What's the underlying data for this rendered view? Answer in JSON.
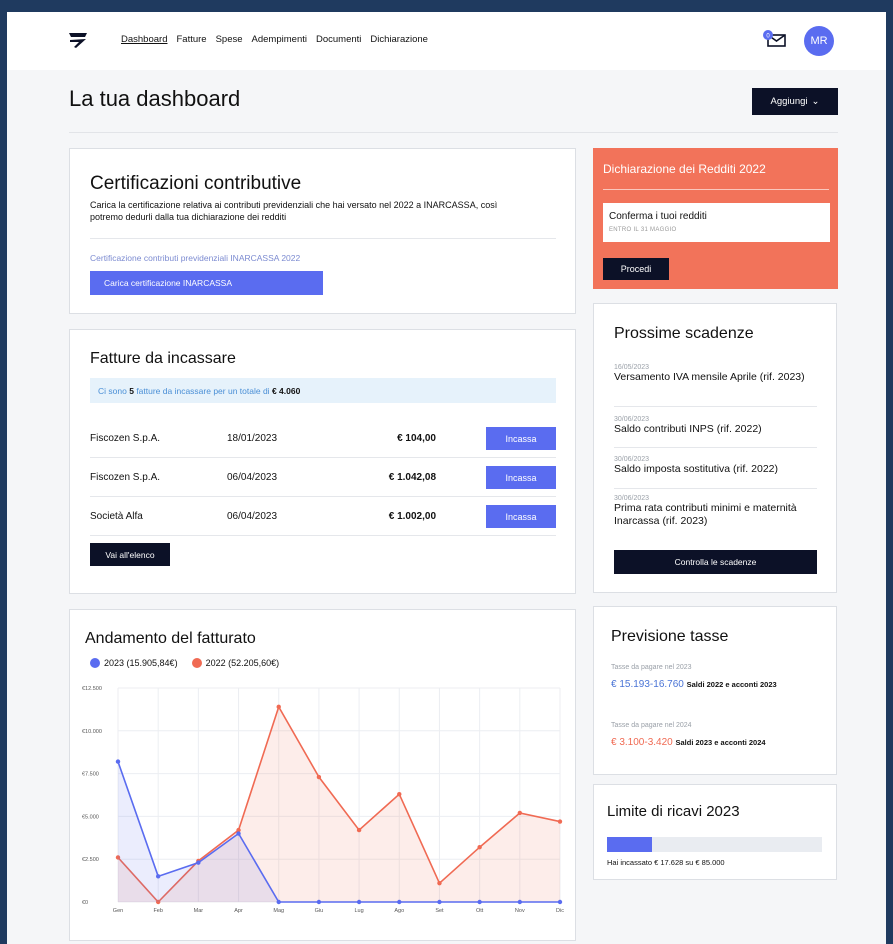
{
  "nav": {
    "items": [
      "Dashboard",
      "Fatture",
      "Spese",
      "Adempimenti",
      "Documenti",
      "Dichiarazione"
    ],
    "active": "Dashboard"
  },
  "header": {
    "mail_badge": "0",
    "avatar_initials": "MR",
    "title": "La tua dashboard",
    "add_button": "Aggiungi"
  },
  "certificazioni": {
    "title": "Certificazioni contributive",
    "description": "Carica la certificazione relativa ai contributi previdenziali che hai versato nel 2022 a INARCASSA, così potremo dedurli dalla tua dichiarazione dei redditi",
    "link_text": "Certificazione contributi previdenziali INARCASSA 2022",
    "upload_button": "Carica certificazione INARCASSA"
  },
  "fatture": {
    "title": "Fatture da incassare",
    "banner_prefix": "Ci sono",
    "banner_count": "5",
    "banner_middle": "fatture da incassare per un totale di",
    "banner_total": "€ 4.060",
    "rows": [
      {
        "name": "Fiscozen S.p.A.",
        "date": "18/01/2023",
        "amount": "€ 104,00",
        "action": "Incassa"
      },
      {
        "name": "Fiscozen S.p.A.",
        "date": "06/04/2023",
        "amount": "€ 1.042,08",
        "action": "Incassa"
      },
      {
        "name": "Società Alfa",
        "date": "06/04/2023",
        "amount": "€ 1.002,00",
        "action": "Incassa"
      }
    ],
    "all_button": "Vai all'elenco"
  },
  "dichiarazione": {
    "title": "Dichiarazione dei Redditi 2022",
    "box_title": "Conferma i tuoi redditi",
    "box_sub": "ENTRO IL 31 MAGGIO",
    "button": "Procedi"
  },
  "scadenze": {
    "title": "Prossime scadenze",
    "items": [
      {
        "date": "16/05/2023",
        "text": "Versamento IVA mensile Aprile (rif. 2023)"
      },
      {
        "date": "30/06/2023",
        "text": "Saldo contributi INPS (rif. 2022)"
      },
      {
        "date": "30/06/2023",
        "text": "Saldo imposta sostitutiva (rif. 2022)"
      },
      {
        "date": "30/06/2023",
        "text": "Prima rata contributi minimi e maternità Inarcassa (rif. 2023)"
      }
    ],
    "button": "Controlla le scadenze"
  },
  "tasse": {
    "title": "Previsione tasse",
    "lines": [
      {
        "label": "Tasse da pagare nel 2023",
        "range": "€ 15.193-16.760",
        "note": "Saldi 2022 e acconti 2023",
        "color": "#4a74d6"
      },
      {
        "label": "Tasse da pagare nel 2024",
        "range": "€ 3.100-3.420",
        "note": "Saldi 2023 e acconti 2024",
        "color": "#f06a53"
      }
    ]
  },
  "limite": {
    "title": "Limite di ricavi 2023",
    "progress": 0.207,
    "caption": "Hai incassato € 17.628 su € 85.000"
  },
  "chart_data": {
    "type": "area",
    "title": "Andamento del fatturato",
    "categories": [
      "Gen",
      "Feb",
      "Mar",
      "Apr",
      "Mag",
      "Giu",
      "Lug",
      "Ago",
      "Set",
      "Ott",
      "Nov",
      "Dic"
    ],
    "yticks": [
      "€12.500",
      "€10.000",
      "€7.500",
      "€5.000",
      "€2.500",
      "€0"
    ],
    "ylim": [
      0,
      12500
    ],
    "series": [
      {
        "name": "2023 (15.905,84€)",
        "color": "#5a6cf0",
        "values": [
          8200,
          1500,
          2300,
          4000,
          0,
          0,
          0,
          0,
          0,
          0,
          0,
          0
        ]
      },
      {
        "name": "2022 (52.205,60€)",
        "color": "#f06a53",
        "values": [
          2600,
          0,
          2400,
          4200,
          11400,
          7300,
          4200,
          6300,
          1100,
          3200,
          5200,
          4700
        ]
      }
    ]
  }
}
